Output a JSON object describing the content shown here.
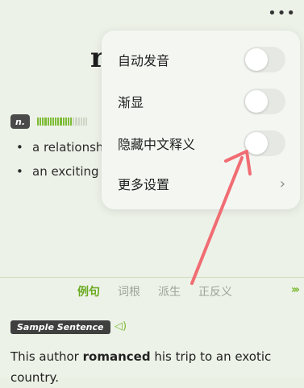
{
  "header": {
    "word": "r",
    "more_icon": "more-icon"
  },
  "entry": {
    "pos": "n.",
    "freq_level": 0.7,
    "definitions": [
      "a relationsh",
      "an exciting a heroic time"
    ]
  },
  "menu": {
    "items": [
      {
        "label": "自动发音",
        "toggle": false
      },
      {
        "label": "渐显",
        "toggle": false
      },
      {
        "label": "隐藏中文释义",
        "toggle": false
      },
      {
        "label": "更多设置"
      }
    ]
  },
  "tabs": [
    "例句",
    "词根",
    "派生",
    "正反义"
  ],
  "sample": {
    "badge": "Sample Sentence",
    "sentence_before": "This author ",
    "sentence_bold": "romanced",
    "sentence_after": " his trip to an exotic country."
  },
  "colors": {
    "accent": "#7dbb36",
    "arrow": "#f06d73"
  }
}
